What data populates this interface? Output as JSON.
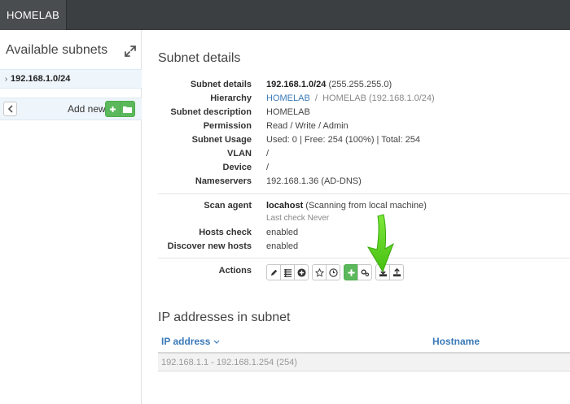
{
  "app": {
    "brand": "HOMELAB"
  },
  "sidebar": {
    "title": "Available subnets",
    "subnet": {
      "chevron": "›",
      "label": "192.168.1.0/24"
    },
    "add_new_label": "Add new"
  },
  "details": {
    "title": "Subnet details",
    "rows": {
      "subnet_details": {
        "label": "Subnet details",
        "subnet": "192.168.1.0/24",
        "mask": "(255.255.255.0)"
      },
      "hierarchy": {
        "label": "Hierarchy",
        "link": "HOMELAB",
        "separator": "/",
        "rest": "HOMELAB (192.168.1.0/24)"
      },
      "description": {
        "label": "Subnet description",
        "value": "HOMELAB"
      },
      "permission": {
        "label": "Permission",
        "value": "Read / Write / Admin"
      },
      "usage": {
        "label": "Subnet Usage",
        "value": "Used: 0 | Free: 254 (100%) | Total: 254"
      },
      "vlan": {
        "label": "VLAN",
        "value": "/"
      },
      "device": {
        "label": "Device",
        "value": "/"
      },
      "nameservers": {
        "label": "Nameservers",
        "value": "192.168.1.36 (AD-DNS)"
      },
      "scan_agent": {
        "label": "Scan agent",
        "agent": "locahost",
        "detail": "(Scanning from local machine)",
        "last_check": "Last check Never"
      },
      "hosts_check": {
        "label": "Hosts check",
        "value": "enabled"
      },
      "discover": {
        "label": "Discover new hosts",
        "value": "enabled"
      },
      "actions": {
        "label": "Actions"
      }
    }
  },
  "ip_section": {
    "title": "IP addresses in subnet",
    "columns": {
      "ip": "IP address",
      "hostname": "Hostname"
    },
    "range_row": "192.168.1.1 - 192.168.1.254 (254)"
  },
  "colors": {
    "accent": "#3a7ab8",
    "success": "#5cb85c",
    "topbar": "#3c3f41",
    "arrow": "#5fd41b"
  }
}
